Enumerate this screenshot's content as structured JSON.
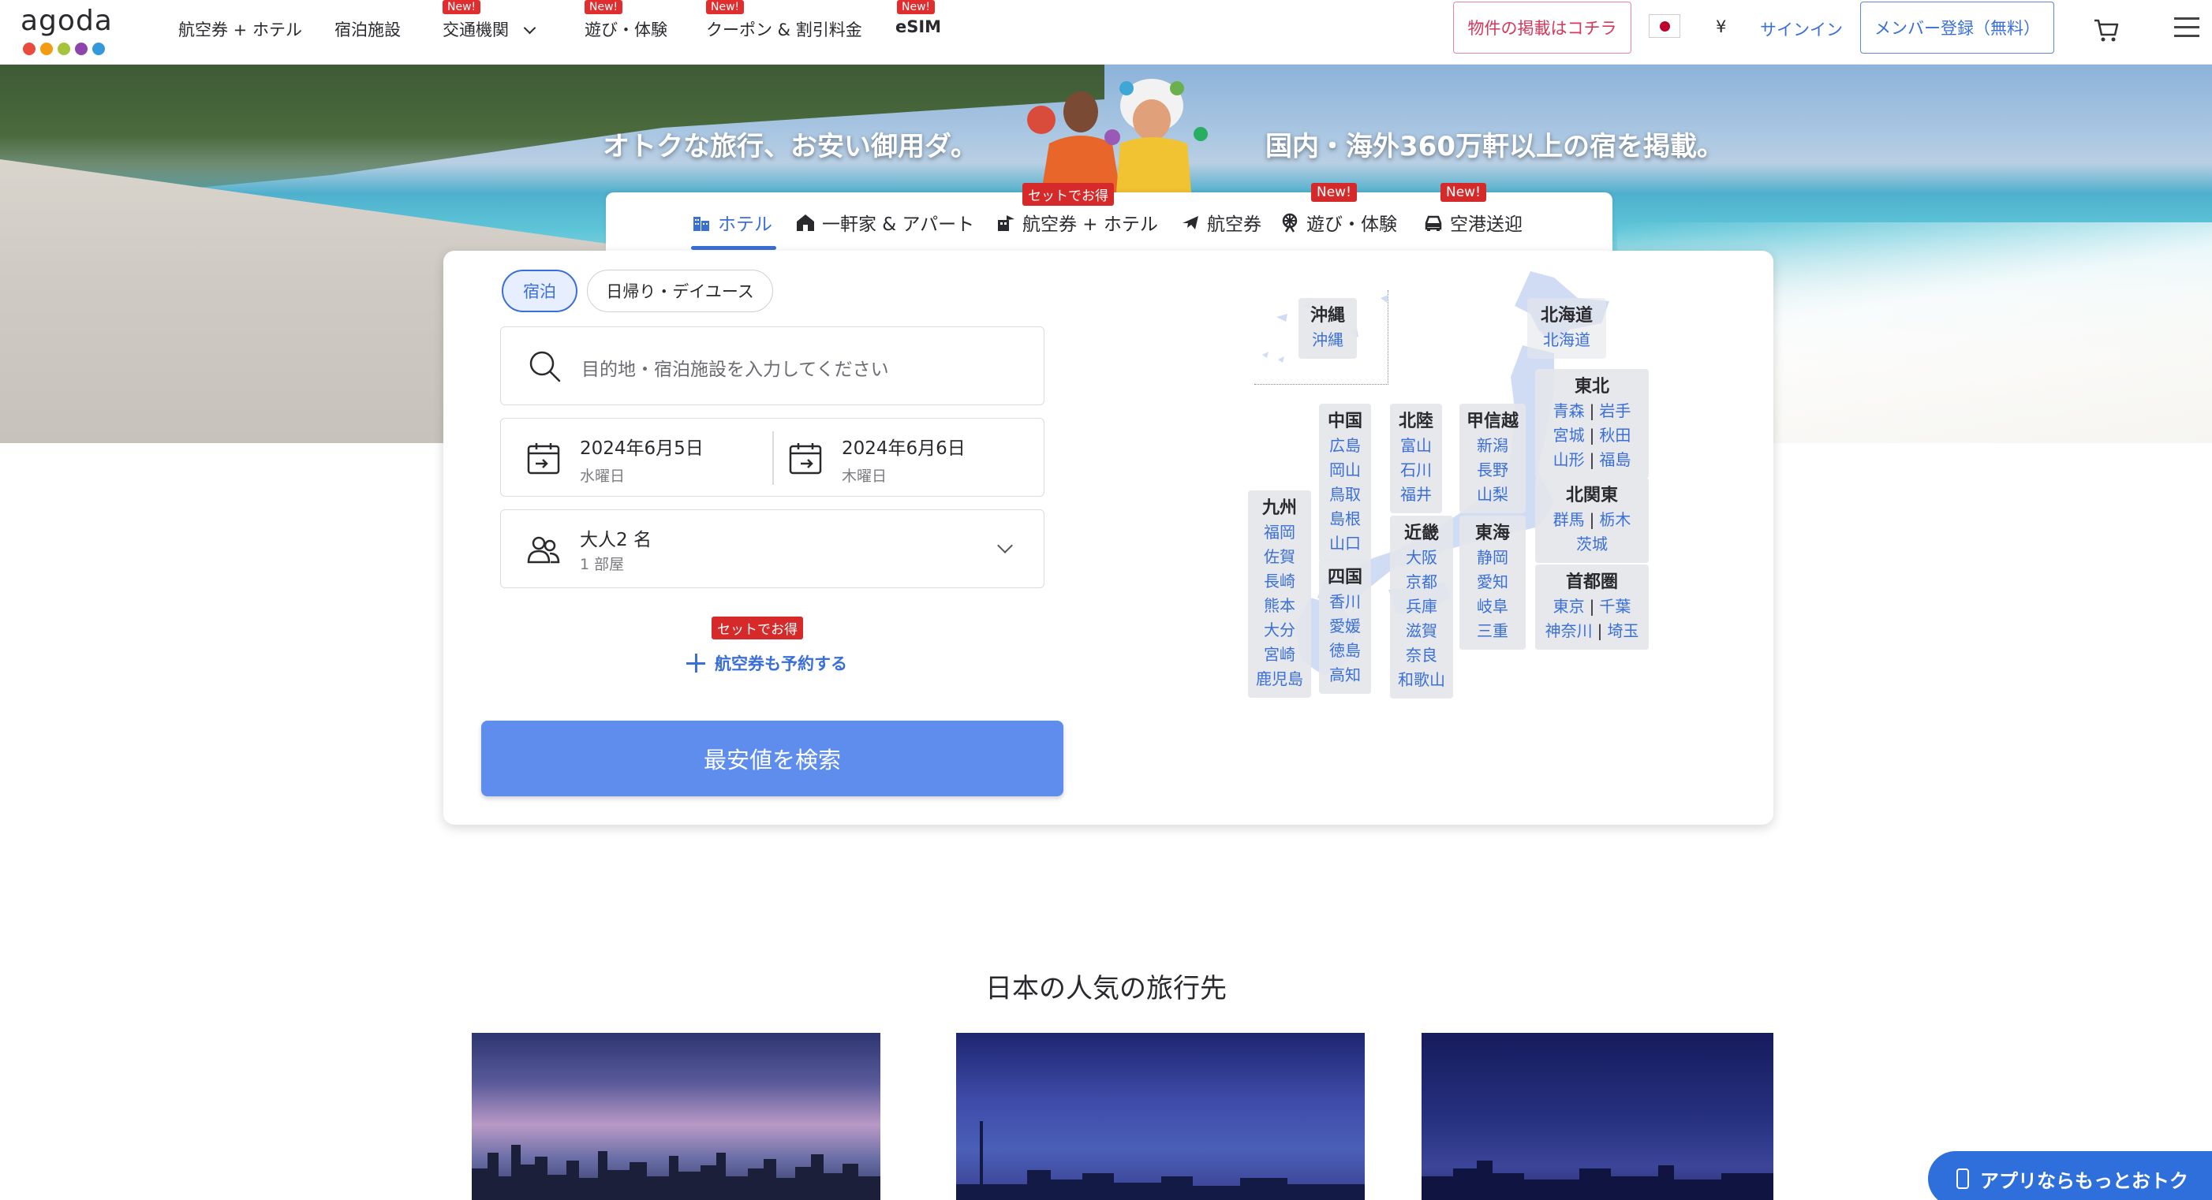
{
  "header": {
    "logo": "agoda",
    "logo_dot_colors": [
      "#e74c3c",
      "#f39c12",
      "#a6c43b",
      "#8e44ad",
      "#3498db"
    ],
    "nav": [
      {
        "label": "航空券 + ホテル",
        "new": ""
      },
      {
        "label": "宿泊施設",
        "new": ""
      },
      {
        "label": "交通機関",
        "new": "New!"
      },
      {
        "label": "遊び・体験",
        "new": "New!"
      },
      {
        "label": "クーポン & 割引料金",
        "new": "New!"
      },
      {
        "label": "eSIM",
        "new": "New!"
      }
    ],
    "list_property": "物件の掲載はコチラ",
    "currency": "¥",
    "signin": "サインイン",
    "register": "メンバー登録（無料）"
  },
  "hero": {
    "left_text": "オトクな旅行、お安い御用ダ。",
    "right_text": "国内・海外360万軒以上の宿を掲載。"
  },
  "search_tabs": [
    {
      "label": "ホテル",
      "tag": ""
    },
    {
      "label": "一軒家 & アパート",
      "tag": ""
    },
    {
      "label": "航空券 + ホテル",
      "tag": "セットでお得"
    },
    {
      "label": "航空券",
      "tag": ""
    },
    {
      "label": "遊び・体験",
      "tag": "New!"
    },
    {
      "label": "空港送迎",
      "tag": "New!"
    }
  ],
  "search": {
    "pill_overnight": "宿泊",
    "pill_daytrip": "日帰り・デイユース",
    "destination_placeholder": "目的地・宿泊施設を入力してください",
    "checkin_date": "2024年6月5日",
    "checkin_day": "水曜日",
    "checkout_date": "2024年6月6日",
    "checkout_day": "木曜日",
    "guests": "大人2 名",
    "rooms": "1 部屋",
    "bundle_tag": "セットでお得",
    "add_flight": "航空券も予約する",
    "search_button": "最安値を検索"
  },
  "map": {
    "okinawa": {
      "title": "沖縄",
      "prefs": [
        "沖縄"
      ]
    },
    "hokkaido": {
      "title": "北海道",
      "prefs": [
        "北海道"
      ]
    },
    "tohoku": {
      "title": "東北",
      "rows": [
        [
          "青森",
          "岩手"
        ],
        [
          "宮城",
          "秋田"
        ],
        [
          "山形",
          "福島"
        ]
      ]
    },
    "kitakanto": {
      "title": "北関東",
      "rows": [
        [
          "群馬",
          "栃木"
        ],
        [
          "茨城"
        ]
      ]
    },
    "shutoken": {
      "title": "首都圏",
      "rows": [
        [
          "東京",
          "千葉"
        ],
        [
          "神奈川",
          "埼玉"
        ]
      ]
    },
    "chugoku": {
      "title": "中国",
      "prefs": [
        "広島",
        "岡山",
        "鳥取",
        "島根",
        "山口"
      ]
    },
    "hokuriku": {
      "title": "北陸",
      "prefs": [
        "富山",
        "石川",
        "福井"
      ]
    },
    "koshinetsu": {
      "title": "甲信越",
      "prefs": [
        "新潟",
        "長野",
        "山梨"
      ]
    },
    "kyushu": {
      "title": "九州",
      "prefs": [
        "福岡",
        "佐賀",
        "長崎",
        "熊本",
        "大分",
        "宮崎",
        "鹿児島"
      ]
    },
    "shikoku": {
      "title": "四国",
      "prefs": [
        "香川",
        "愛媛",
        "徳島",
        "高知"
      ]
    },
    "kinki": {
      "title": "近畿",
      "prefs": [
        "大阪",
        "京都",
        "兵庫",
        "滋賀",
        "奈良",
        "和歌山"
      ]
    },
    "tokai": {
      "title": "東海",
      "prefs": [
        "静岡",
        "愛知",
        "岐阜",
        "三重"
      ]
    }
  },
  "popular": {
    "title": "日本の人気の旅行先"
  },
  "app_banner": "アプリならもっとおトク",
  "colors": {
    "brand_blue": "#3a6fd8",
    "search_button": "#5e8ded",
    "new_tag": "#e12d2d",
    "list_property_border": "#e4879c"
  }
}
